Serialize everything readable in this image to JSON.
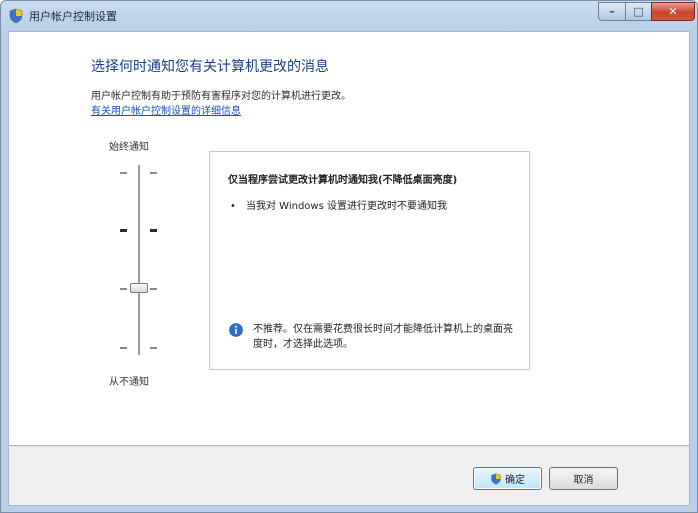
{
  "window": {
    "title": "用户帐户控制设置",
    "controls": {
      "minimize": "–",
      "maximize": "□",
      "close": "✕"
    }
  },
  "main": {
    "heading": "选择何时通知您有关计算机更改的消息",
    "description": "用户帐户控制有助于预防有害程序对您的计算机进行更改。",
    "more_link": "有关用户帐户控制设置的详细信息"
  },
  "slider": {
    "top_label": "始终通知",
    "bottom_label": "从不通知",
    "levels": 4,
    "selected_level": 2
  },
  "info_panel": {
    "title": "仅当程序尝试更改计算机时通知我(不降低桌面亮度)",
    "bullet": "当我对 Windows 设置进行更改时不要通知我",
    "note": "不推荐。仅在需要花费很长时间才能降低计算机上的桌面亮度时，才选择此选项。"
  },
  "buttons": {
    "ok": "确定",
    "cancel": "取消"
  },
  "icons": {
    "title": "uac-shield-icon",
    "note": "info-icon",
    "ok": "uac-shield-icon"
  },
  "colors": {
    "heading": "#1e3f87",
    "link": "#1a4fbd",
    "close_button": "#c7452b"
  }
}
